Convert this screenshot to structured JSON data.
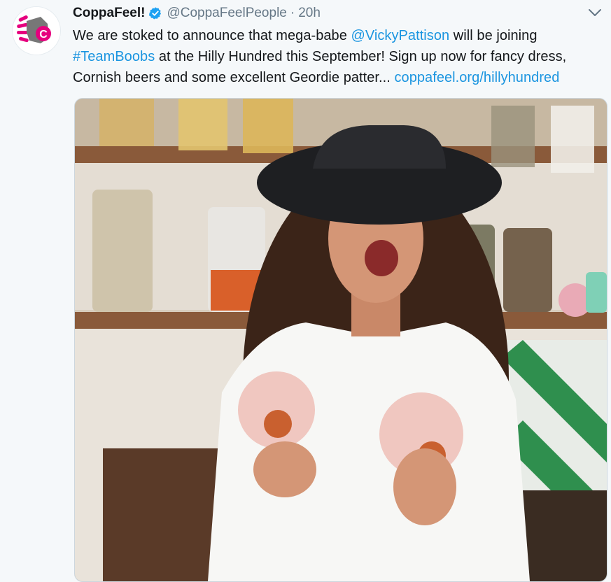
{
  "tweet": {
    "author": {
      "display_name": "CoppaFeel!",
      "handle": "@CoppaFeelPeople",
      "verified": true,
      "avatar_icon": "coppafeel-hand-logo-icon"
    },
    "separator": "·",
    "time": "20h",
    "body": {
      "part1": "We are stoked to announce that mega-babe ",
      "mention": "@VickyPattison",
      "part2": " will be joining ",
      "hashtag": "#TeamBoobs",
      "part3": " at the Hilly Hundred this September! Sign up now for fancy dress, Cornish beers and some excellent Geordie patter... ",
      "url": "coppafeel.org/hillyhundred"
    },
    "menu_icon": "chevron-down-icon"
  },
  "colors": {
    "link": "#1b95e0",
    "secondary_text": "#657786",
    "verified": "#1da1f2",
    "brand_pink": "#e6007e"
  }
}
